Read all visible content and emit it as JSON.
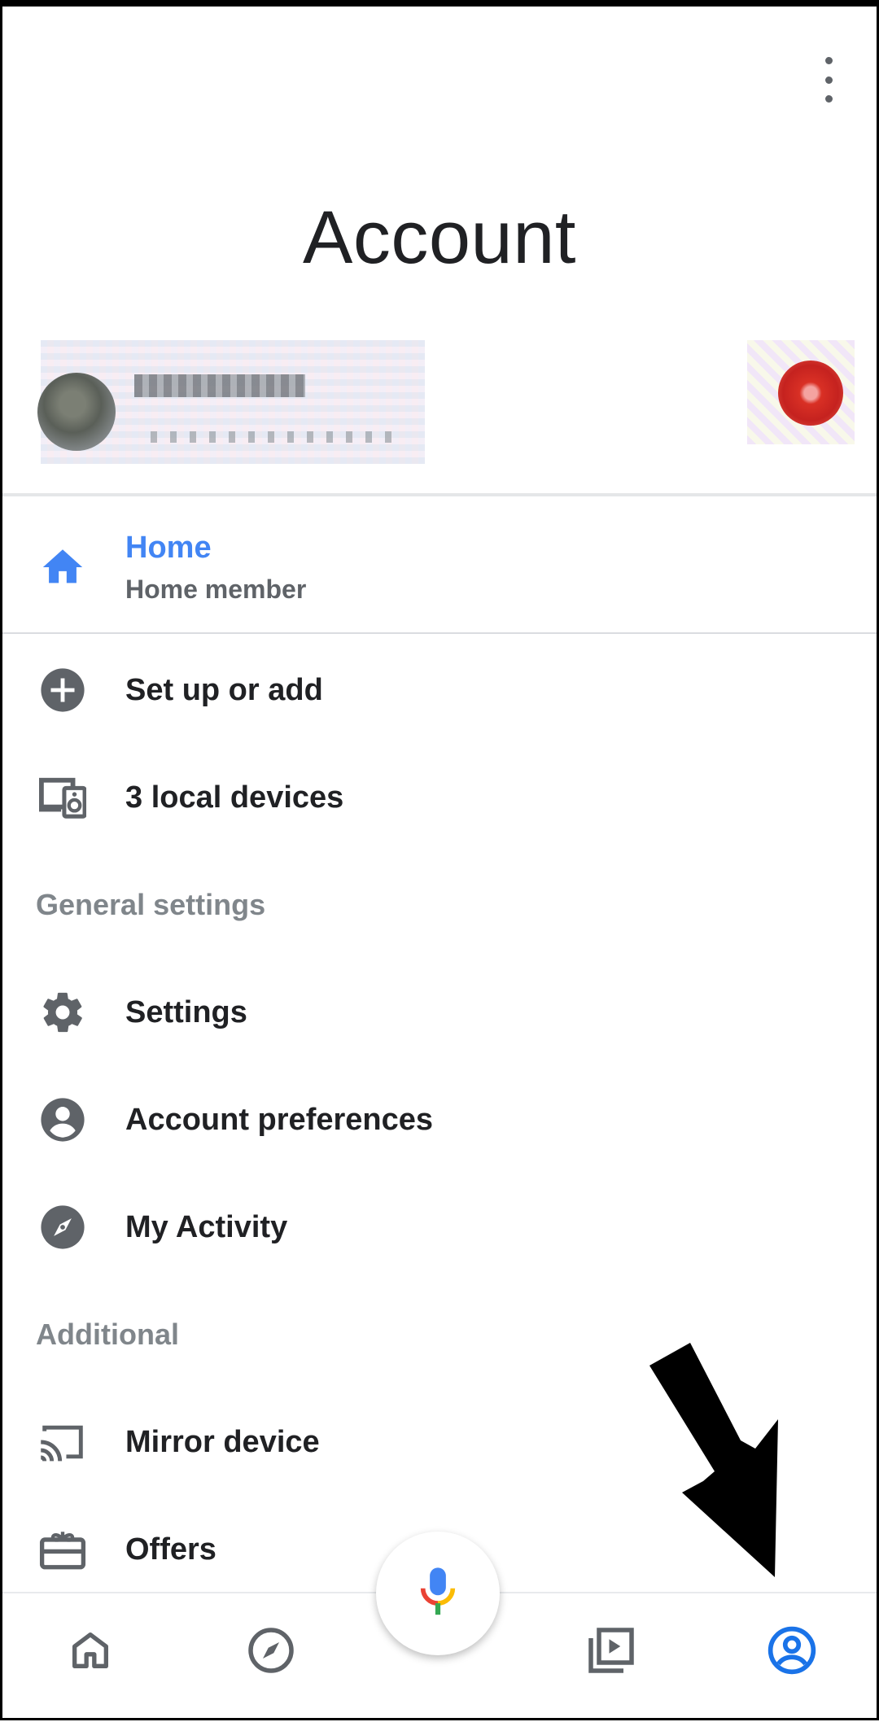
{
  "header": {
    "title": "Account",
    "overflow_menu_icon": "more-vert-icon"
  },
  "account": {
    "avatar_icon": "account-avatar",
    "profile_icon": "profile-picture"
  },
  "home": {
    "label": "Home",
    "subtitle": "Home member",
    "icon": "home-icon",
    "accent": "#4285f4"
  },
  "items_top": [
    {
      "label": "Set up or add",
      "icon": "add-circle-icon"
    },
    {
      "label": "3 local devices",
      "icon": "devices-icon"
    }
  ],
  "general_settings": {
    "header": "General settings",
    "items": [
      {
        "label": "Settings",
        "icon": "gear-icon"
      },
      {
        "label": "Account preferences",
        "icon": "account-circle-icon"
      },
      {
        "label": "My Activity",
        "icon": "compass-icon"
      }
    ]
  },
  "additional": {
    "header": "Additional",
    "items": [
      {
        "label": "Mirror device",
        "icon": "cast-icon"
      },
      {
        "label": "Offers",
        "icon": "gift-icon"
      }
    ]
  },
  "bottom_nav": {
    "items": [
      {
        "icon": "home-icon",
        "selected": false
      },
      {
        "icon": "explore-icon",
        "selected": false
      },
      {
        "icon": "media-icon",
        "selected": false
      },
      {
        "icon": "account-icon",
        "selected": true
      }
    ],
    "mic_icon": "mic-icon",
    "selected_color": "#1a73e8"
  },
  "annotation": {
    "icon": "pointer-arrow"
  }
}
